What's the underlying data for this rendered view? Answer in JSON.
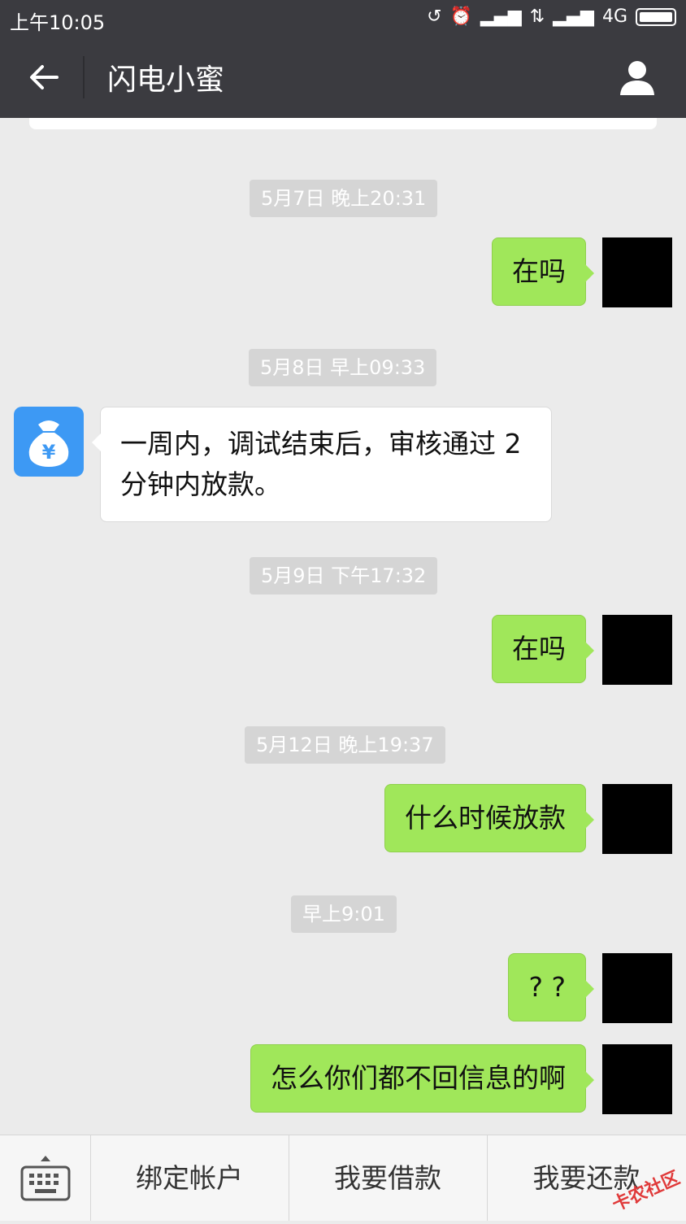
{
  "status_bar": {
    "time": "上午10:05",
    "network": "4G"
  },
  "header": {
    "title": "闪电小蜜"
  },
  "messages": [
    {
      "type": "timestamp",
      "text": "5月7日 晚上20:31"
    },
    {
      "type": "sent",
      "text": "在吗"
    },
    {
      "type": "timestamp",
      "text": "5月8日 早上09:33"
    },
    {
      "type": "received",
      "text": "一周内，调试结束后，审核通过 2 分钟内放款。"
    },
    {
      "type": "timestamp",
      "text": "5月9日 下午17:32"
    },
    {
      "type": "sent",
      "text": "在吗"
    },
    {
      "type": "timestamp",
      "text": "5月12日 晚上19:37"
    },
    {
      "type": "sent",
      "text": "什么时候放款"
    },
    {
      "type": "timestamp",
      "text": "早上9:01"
    },
    {
      "type": "sent",
      "text": "? ?"
    },
    {
      "type": "sent",
      "text": "怎么你们都不回信息的啊"
    }
  ],
  "bottom_menu": {
    "items": [
      "绑定帐户",
      "我要借款",
      "我要还款"
    ]
  },
  "watermark": "卡农社区",
  "colors": {
    "bar": "#3b3b40",
    "sent_bubble": "#a0e75a",
    "received_bubble": "#ffffff",
    "bot_avatar": "#3d99f4"
  }
}
